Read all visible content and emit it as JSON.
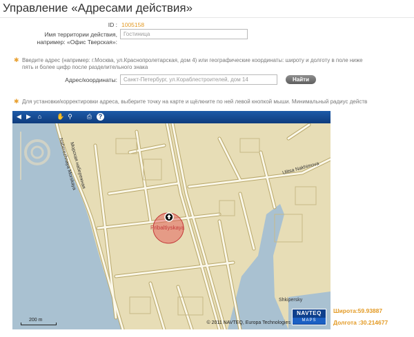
{
  "page": {
    "title": "Управление «Адресами действия»"
  },
  "form": {
    "id_label": "ID :",
    "id_value": "1005158",
    "territory_label_line1": "Имя территории действия,",
    "territory_label_line2": "например: «Офис Тверская»:",
    "territory_value": "Гостиница",
    "address_hint_line1": "Введите адрес (например: г.Москва, ул.Краснопролетарская, дом 4) или географические координаты: широту и долготу в поле ниже",
    "address_hint_line2": "пять и более цифр после разделительного знака",
    "address_label": "Адрес/координаты:",
    "address_value": "Санкт-Петербург, ул.Кораблестроителей, дом 14",
    "find_button": "Найти",
    "map_hint": "Для установки/корректировки адреса, выберите точку на карте и щёлкните по ней левой кнопкой мыши. Минимальный радиус действ"
  },
  "map": {
    "streets": {
      "ulitsa_nakhimova": "Ulitsa Nakhimova",
      "naberezhnaya": "Naberezhnaya Morskaya",
      "morskaya": "Морская набережная",
      "pribaltiyskaya": "Pribaltiyskaya",
      "shkipersky": "Shkipersky"
    },
    "scale": "200 m",
    "copyright": "© 2011 NAVTEQ, Europa Technologies",
    "navteq_top": "NAVTEQ",
    "navteq_bottom": "MAPS",
    "colors": {
      "land": "#e7ddb6",
      "water": "#a9c1d1",
      "road_fill": "#fbf8ea",
      "road_edge": "#b8a76a",
      "toolbar": "#0f3c7d",
      "marker": "#e24b4b"
    }
  },
  "coordinates": {
    "latitude": "Широта:59.93887",
    "longitude": "Долгота :30.214677"
  }
}
